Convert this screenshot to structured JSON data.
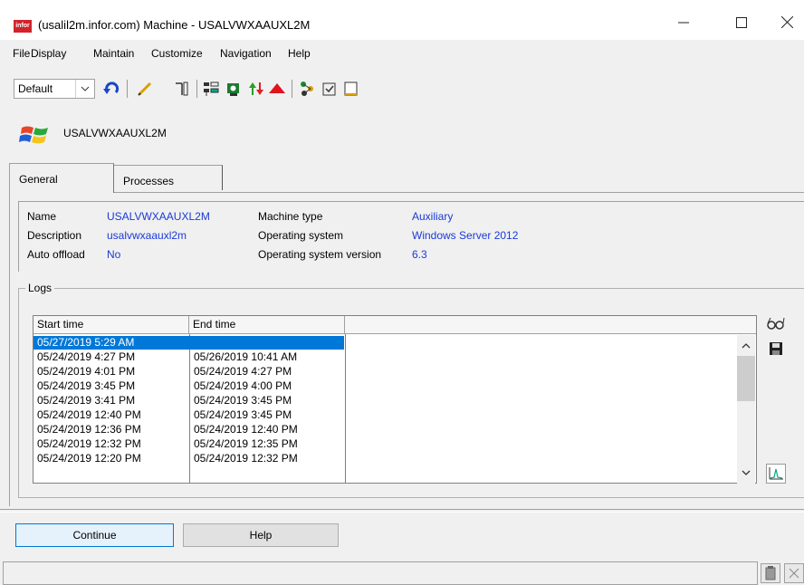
{
  "window": {
    "logo_text": "infor",
    "title": "(usalil2m.infor.com) Machine - USALVWXAAUXL2M",
    "minimize": "—",
    "maximize": "☐",
    "close": "✕"
  },
  "menu": [
    "File",
    "Display",
    "Maintain",
    "Customize",
    "Navigation",
    "Help"
  ],
  "toolbar": {
    "view_select": "Default",
    "icons": [
      "refresh-icon",
      "edit-icon",
      "filter-icon",
      "tree-icon",
      "sync-icon",
      "transfer-icon",
      "up-triangle-icon",
      "connect-icon",
      "check-icon",
      "blank-doc-icon"
    ]
  },
  "machine": {
    "name": "USALVWXAAUXL2M"
  },
  "tabs": [
    {
      "label": "General",
      "active": true
    },
    {
      "label": "Processes",
      "active": false
    }
  ],
  "general": {
    "name_label": "Name",
    "name_value": "USALVWXAAUXL2M",
    "description_label": "Description",
    "description_value": "usalvwxaauxl2m",
    "auto_offload_label": "Auto offload",
    "auto_offload_value": "No",
    "machine_type_label": "Machine type",
    "machine_type_value": "Auxiliary",
    "os_label": "Operating system",
    "os_value": "Windows Server 2012",
    "os_version_label": "Operating system version",
    "os_version_value": "6.3"
  },
  "logs": {
    "group_label": "Logs",
    "columns": [
      "Start time",
      "End time"
    ],
    "rows": [
      {
        "start": "05/27/2019 5:29 AM",
        "end": "",
        "selected": true
      },
      {
        "start": "05/24/2019 4:27 PM",
        "end": "05/26/2019 10:41 AM"
      },
      {
        "start": "05/24/2019 4:01 PM",
        "end": "05/24/2019 4:27 PM"
      },
      {
        "start": "05/24/2019 3:45 PM",
        "end": "05/24/2019 4:00 PM"
      },
      {
        "start": "05/24/2019 3:41 PM",
        "end": "05/24/2019 3:45 PM"
      },
      {
        "start": "05/24/2019 12:40 PM",
        "end": "05/24/2019 3:45 PM"
      },
      {
        "start": "05/24/2019 12:36 PM",
        "end": "05/24/2019 12:40 PM"
      },
      {
        "start": "05/24/2019 12:32 PM",
        "end": "05/24/2019 12:35 PM"
      },
      {
        "start": "05/24/2019 12:20 PM",
        "end": "05/24/2019 12:32 PM"
      }
    ]
  },
  "buttons": {
    "continue": "Continue",
    "help": "Help"
  },
  "colors": {
    "value_blue": "#1a3ad8",
    "selection": "#0078d7",
    "logo_red": "#d2232a"
  }
}
